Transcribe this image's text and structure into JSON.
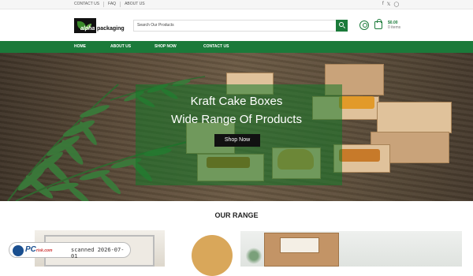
{
  "topbar": {
    "links": [
      "CONTACT US",
      "FAQ",
      "ABOUT US"
    ],
    "social_icons": [
      "facebook-icon",
      "twitter-icon",
      "instagram-icon"
    ]
  },
  "header": {
    "logo": {
      "word1": "alpha",
      "word2": "packaging"
    },
    "search_placeholder": "Search Our Products",
    "cart": {
      "price": "$0.00",
      "items": "0 items"
    }
  },
  "nav": {
    "items": [
      "HOME",
      "ABOUT US",
      "SHOP NOW",
      "CONTACT US"
    ]
  },
  "hero": {
    "line1": "Kraft Cake Boxes",
    "line2": "Wide Range Of Products",
    "button": "Shop Now"
  },
  "range": {
    "title": "OUR RANGE"
  },
  "watermark": {
    "brand": "PC",
    "sub": "risk.com",
    "scanned": "scanned 2026-07-01"
  },
  "colors": {
    "brand_green": "#1b7a3a",
    "button_black": "#111111",
    "kraft": "#c9a37a"
  }
}
